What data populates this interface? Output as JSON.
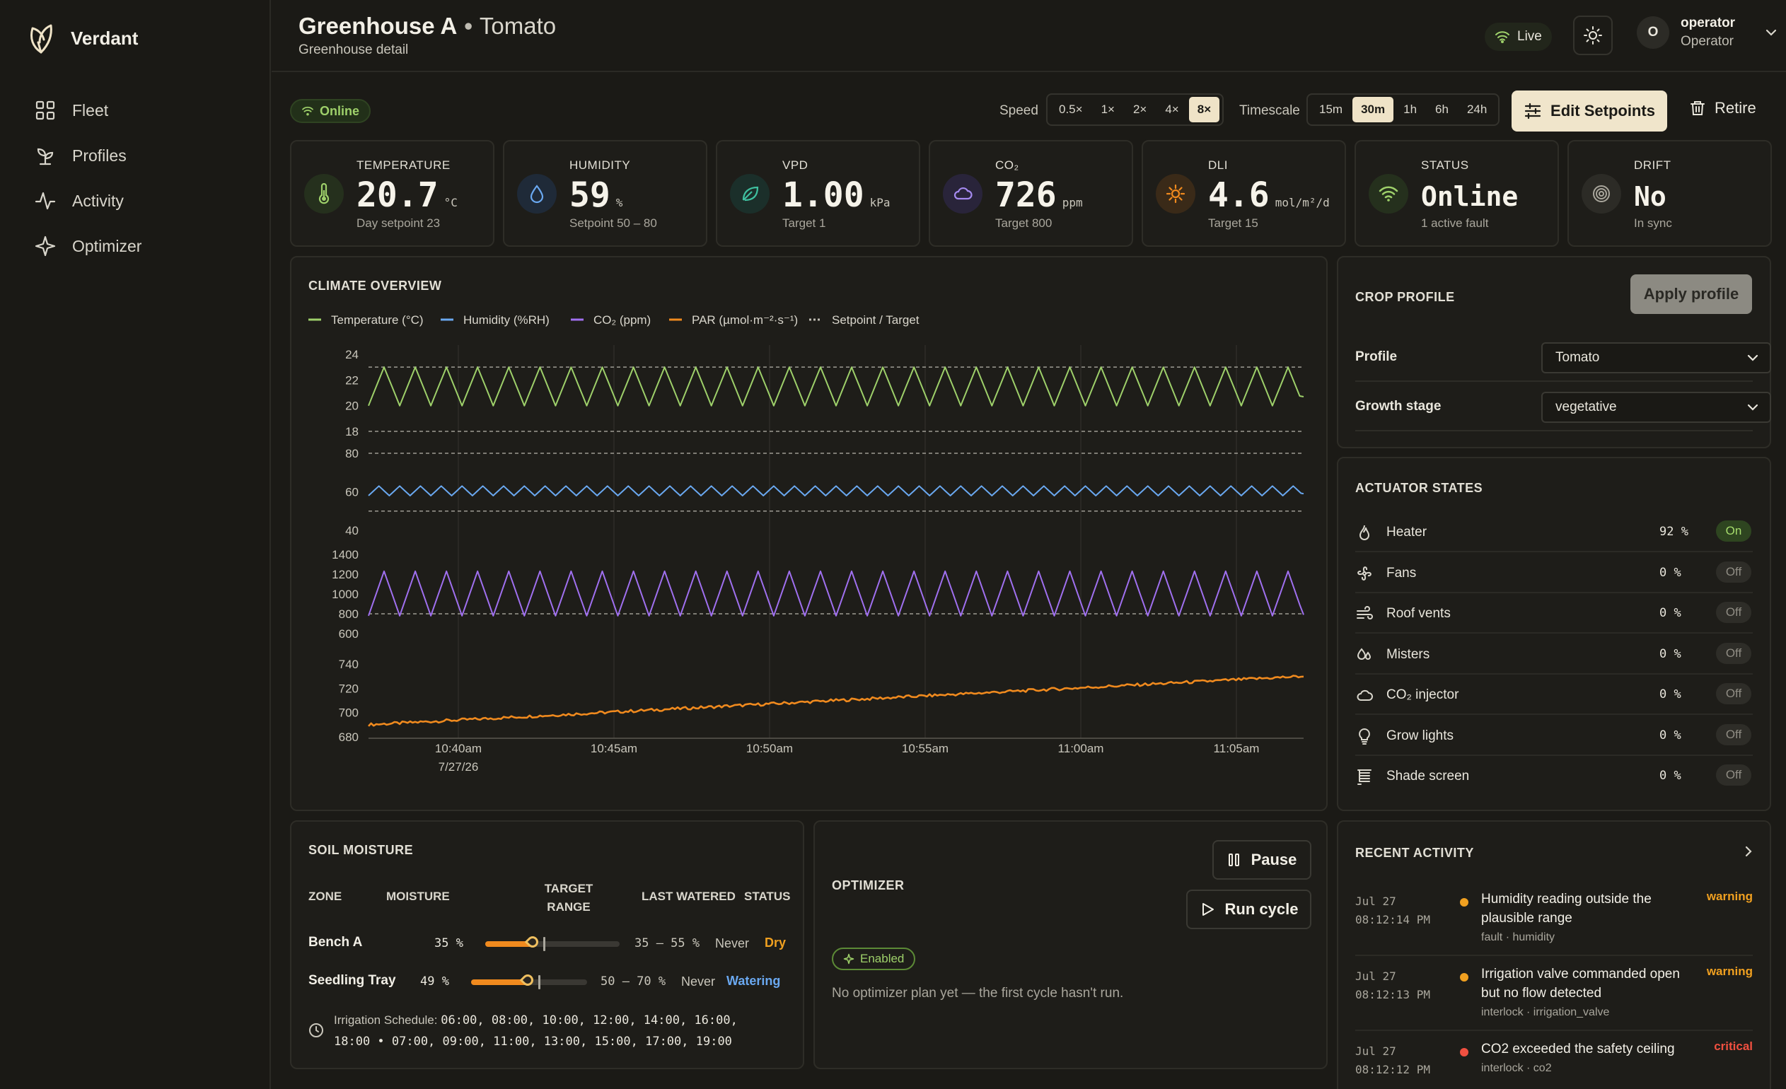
{
  "app": {
    "name": "Verdant"
  },
  "sidebar": {
    "items": [
      {
        "label": "Fleet",
        "icon": "grid-icon"
      },
      {
        "label": "Profiles",
        "icon": "sprout-icon"
      },
      {
        "label": "Activity",
        "icon": "activity-icon"
      },
      {
        "label": "Optimizer",
        "icon": "sparkle-icon"
      }
    ]
  },
  "header": {
    "title": "Greenhouse A",
    "separator": "•",
    "crop": "Tomato",
    "subtitle": "Greenhouse detail",
    "live": "Live",
    "user": {
      "initial": "O",
      "name": "operator",
      "role": "Operator"
    }
  },
  "toolbar": {
    "status": "Online",
    "speed_label": "Speed",
    "speeds": [
      "0.5×",
      "1×",
      "2×",
      "4×",
      "8×"
    ],
    "speed_active": "8×",
    "timescale_label": "Timescale",
    "timescales": [
      "15m",
      "30m",
      "1h",
      "6h",
      "24h"
    ],
    "timescale_active": "30m",
    "edit_setpoints": "Edit Setpoints",
    "retire": "Retire"
  },
  "kpis": [
    {
      "label": "TEMPERATURE",
      "value": "20.7",
      "unit": "°C",
      "foot": "Day setpoint 23",
      "icon": "thermometer-icon",
      "color": "#9ed06a",
      "bg": "#25301d"
    },
    {
      "label": "HUMIDITY",
      "value": "59",
      "unit": "%",
      "foot": "Setpoint 50 – 80",
      "icon": "droplet-icon",
      "color": "#6aa8f0",
      "bg": "#1f2a38"
    },
    {
      "label": "VPD",
      "value": "1.00",
      "unit": "kPa",
      "foot": "Target 1",
      "icon": "leaf-icon",
      "color": "#3fc0a0",
      "bg": "#1b2f2a"
    },
    {
      "label": "CO₂",
      "value": "726",
      "unit": "ppm",
      "foot": "Target 800",
      "icon": "cloud-icon",
      "color": "#a58af0",
      "bg": "#29243a"
    },
    {
      "label": "DLI",
      "value": "4.6",
      "unit": "mol/m²/d",
      "foot": "Target 15",
      "icon": "sun-icon",
      "color": "#f08a1e",
      "bg": "#3a2a18"
    },
    {
      "label": "STATUS",
      "value": "Online",
      "unit": "",
      "foot": "1 active fault",
      "icon": "wifi-icon",
      "color": "#9ed06a",
      "bg": "#25301d"
    },
    {
      "label": "DRIFT",
      "value": "No",
      "unit": "",
      "foot": "In sync",
      "icon": "target-icon",
      "color": "#a9a69c",
      "bg": "#2c2b26"
    }
  ],
  "climate": {
    "title": "CLIMATE OVERVIEW",
    "legend": [
      "Temperature (°C)",
      "Humidity (%RH)",
      "CO₂ (ppm)",
      "PAR (µmol·m⁻²·s⁻¹)",
      "Setpoint / Target"
    ],
    "colors": {
      "temperature": "#9ed06a",
      "humidity": "#6aa8f0",
      "co2": "#a070f0",
      "par": "#f08a1e",
      "setpoint": "#bfbcb2"
    }
  },
  "chart_data": {
    "type": "line",
    "title": "CLIMATE OVERVIEW",
    "x_ticks": [
      "10:40am",
      "10:45am",
      "10:50am",
      "10:55am",
      "11:00am",
      "11:05am"
    ],
    "x_date": "7/27/26",
    "x_range": [
      "10:38am",
      "11:08am"
    ],
    "panels": [
      {
        "series": "Temperature (°C)",
        "ticks": [
          18,
          20,
          22,
          24
        ],
        "ylim": [
          18,
          24
        ],
        "setpoints": [
          18,
          23
        ],
        "min": 20,
        "max": 23,
        "cycles": 30,
        "final": 20.7
      },
      {
        "series": "Humidity (%RH)",
        "ticks": [
          40,
          60,
          80
        ],
        "ylim": [
          40,
          80
        ],
        "setpoints": [
          50,
          80
        ],
        "min": 58,
        "max": 63,
        "cycles": 45,
        "final": 59
      },
      {
        "series": "CO₂ (ppm)",
        "ticks": [
          600,
          800,
          1000,
          1200,
          1400
        ],
        "ylim": [
          600,
          1400
        ],
        "setpoints": [
          800
        ],
        "min": 780,
        "max": 1230,
        "cycles": 30,
        "final": 790
      },
      {
        "series": "PAR (µmol·m⁻²·s⁻¹)",
        "ticks": [
          680,
          700,
          720,
          740
        ],
        "ylim": [
          680,
          750
        ],
        "start": 690,
        "end": 730
      }
    ],
    "grid": true,
    "legend": "top-left"
  },
  "crop_profile": {
    "title": "CROP PROFILE",
    "apply": "Apply profile",
    "profile_label": "Profile",
    "profile_value": "Tomato",
    "stage_label": "Growth stage",
    "stage_value": "vegetative"
  },
  "actuators": {
    "title": "ACTUATOR STATES",
    "items": [
      {
        "name": "Heater",
        "pct": "92 %",
        "state": "On",
        "icon": "flame-icon"
      },
      {
        "name": "Fans",
        "pct": "0 %",
        "state": "Off",
        "icon": "fan-icon"
      },
      {
        "name": "Roof vents",
        "pct": "0 %",
        "state": "Off",
        "icon": "wind-icon"
      },
      {
        "name": "Misters",
        "pct": "0 %",
        "state": "Off",
        "icon": "droplets-icon"
      },
      {
        "name": "CO₂ injector",
        "pct": "0 %",
        "state": "Off",
        "icon": "cloud-icon"
      },
      {
        "name": "Grow lights",
        "pct": "0 %",
        "state": "Off",
        "icon": "bulb-icon"
      },
      {
        "name": "Shade screen",
        "pct": "0 %",
        "state": "Off",
        "icon": "blinds-icon"
      }
    ]
  },
  "soil": {
    "title": "SOIL MOISTURE",
    "headers": {
      "zone": "ZONE",
      "moisture": "MOISTURE",
      "target": "TARGET RANGE",
      "last": "LAST WATERED",
      "status": "STATUS"
    },
    "rows": [
      {
        "zone": "Bench A",
        "moisture": "35 %",
        "level": 0.35,
        "range_text": "35 – 55 %",
        "target_low": 0.35,
        "target_high": 0.55,
        "last": "Never",
        "status": "Dry",
        "status_color": "#f0a020"
      },
      {
        "zone": "Seedling Tray",
        "moisture": "49 %",
        "level": 0.49,
        "range_text": "50 – 70 %",
        "target_low": 0.5,
        "target_high": 0.7,
        "last": "Never",
        "status": "Watering",
        "status_color": "#6aa8f0"
      }
    ],
    "schedule_label": "Irrigation Schedule:",
    "schedule_line1": "06:00, 08:00, 10:00, 12:00, 14:00, 16:00,",
    "schedule_line2": "18:00 • 07:00, 09:00, 11:00, 13:00, 15:00, 17:00, 19:00"
  },
  "optimizer": {
    "title": "OPTIMIZER",
    "pause": "Pause",
    "run": "Run cycle",
    "enabled": "Enabled",
    "empty": "No optimizer plan yet — the first cycle hasn't run."
  },
  "activity": {
    "title": "RECENT ACTIVITY",
    "items": [
      {
        "date": "Jul 27",
        "time": "08:12:14 PM",
        "msg": "Humidity reading outside the plausible range",
        "meta": "fault · humidity",
        "sev": "warning",
        "color": "#f0a020"
      },
      {
        "date": "Jul 27",
        "time": "08:12:13 PM",
        "msg": "Irrigation valve commanded open but no flow detected",
        "meta": "interlock · irrigation_valve",
        "sev": "warning",
        "color": "#f0a020"
      },
      {
        "date": "Jul 27",
        "time": "08:12:12 PM",
        "msg": "CO2 exceeded the safety ceiling",
        "meta": "interlock · co2",
        "sev": "critical",
        "color": "#f05040"
      }
    ]
  }
}
